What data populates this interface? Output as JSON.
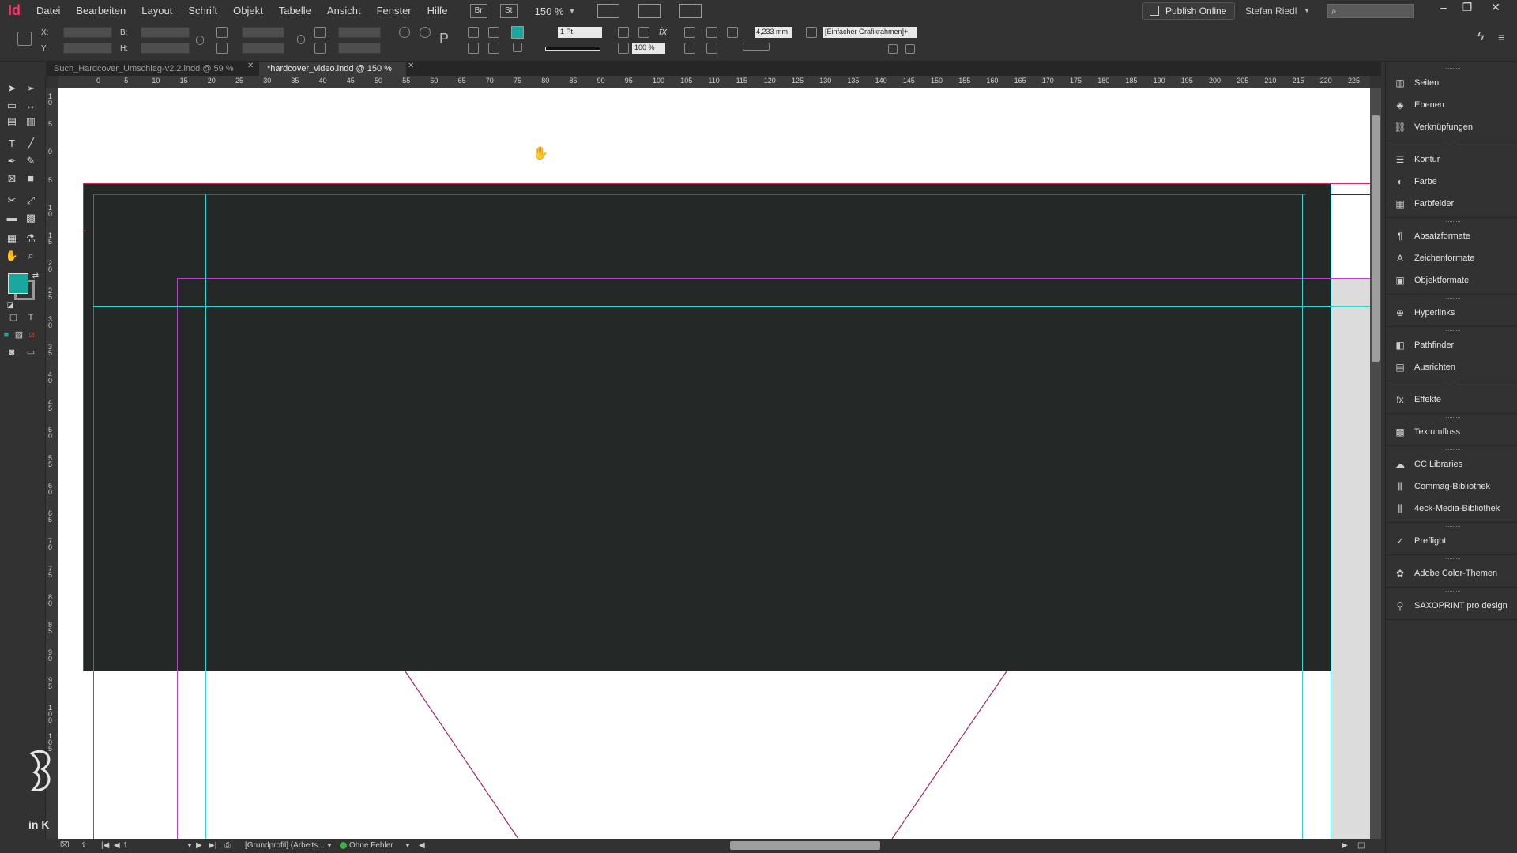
{
  "app": {
    "logo": "Id",
    "menu": [
      "Datei",
      "Bearbeiten",
      "Layout",
      "Schrift",
      "Objekt",
      "Tabelle",
      "Ansicht",
      "Fenster",
      "Hilfe"
    ],
    "bridge_label": "Br",
    "stock_label": "St",
    "zoom": "150 %",
    "publish_online": "Publish Online",
    "user": "Stefan Riedl",
    "accent_color": "#1aa89e",
    "brand_color": "#ff3366"
  },
  "control_panel": {
    "x_label": "X:",
    "y_label": "Y:",
    "w_label": "B:",
    "h_label": "H:",
    "stroke_weight": "1 Pt",
    "opacity": "100 %",
    "dimension": "4,233 mm",
    "object_style": "[Einfacher Grafikrahmen]+"
  },
  "tabs": [
    {
      "label": "Buch_Hardcover_Umschlag-v2.2.indd @ 59 %",
      "active": false
    },
    {
      "label": "*hardcover_video.indd @ 150 %",
      "active": true
    }
  ],
  "ruler_h": [
    "0",
    "5",
    "10",
    "15",
    "20",
    "25",
    "30",
    "35",
    "40",
    "45",
    "50",
    "55",
    "60",
    "65",
    "70",
    "75",
    "80",
    "85",
    "90",
    "95",
    "100",
    "105",
    "110",
    "115",
    "120",
    "125",
    "130",
    "135",
    "140",
    "145",
    "150",
    "155",
    "160",
    "165",
    "170",
    "175",
    "180",
    "185",
    "190",
    "195",
    "200",
    "205",
    "210",
    "215",
    "220",
    "225"
  ],
  "ruler_v": [
    "1\n0",
    "5",
    "0",
    "5",
    "1\n0",
    "1\n5",
    "2\n0",
    "2\n5",
    "3\n0",
    "3\n5",
    "4\n0",
    "4\n5",
    "5\n0",
    "5\n5",
    "6\n0",
    "6\n5",
    "7\n0",
    "7\n5",
    "8\n0",
    "8\n5",
    "9\n0",
    "9\n5",
    "1\n0\n0",
    "1\n0\n5"
  ],
  "panels": [
    {
      "label": "Seiten",
      "icon": "pages-icon",
      "glyph": "▥"
    },
    {
      "label": "Ebenen",
      "icon": "layers-icon",
      "glyph": "◈"
    },
    {
      "label": "Verknüpfungen",
      "icon": "links-icon",
      "glyph": "⛓"
    },
    {
      "label": "Kontur",
      "icon": "stroke-icon",
      "glyph": "☰"
    },
    {
      "label": "Farbe",
      "icon": "color-icon",
      "glyph": "◐"
    },
    {
      "label": "Farbfelder",
      "icon": "swatches-icon",
      "glyph": "▦"
    },
    {
      "label": "Absatzformate",
      "icon": "paragraph-styles-icon",
      "glyph": "¶"
    },
    {
      "label": "Zeichenformate",
      "icon": "character-styles-icon",
      "glyph": "A"
    },
    {
      "label": "Objektformate",
      "icon": "object-styles-icon",
      "glyph": "▣"
    },
    {
      "label": "Hyperlinks",
      "icon": "hyperlinks-icon",
      "glyph": "⊕"
    },
    {
      "label": "Pathfinder",
      "icon": "pathfinder-icon",
      "glyph": "◧"
    },
    {
      "label": "Ausrichten",
      "icon": "align-icon",
      "glyph": "▤"
    },
    {
      "label": "Effekte",
      "icon": "effects-icon",
      "glyph": "fx"
    },
    {
      "label": "Textumfluss",
      "icon": "text-wrap-icon",
      "glyph": "▩"
    },
    {
      "label": "CC Libraries",
      "icon": "cc-libraries-icon",
      "glyph": "☁"
    },
    {
      "label": "Commag-Bibliothek",
      "icon": "library-icon",
      "glyph": "⫼"
    },
    {
      "label": "4eck-Media-Bibliothek",
      "icon": "library-icon",
      "glyph": "⫼"
    },
    {
      "label": "Preflight",
      "icon": "preflight-icon",
      "glyph": "✓"
    },
    {
      "label": "Adobe Color-Themen",
      "icon": "color-themes-icon",
      "glyph": "✿"
    },
    {
      "label": "SAXOPRINT pro design",
      "icon": "saxoprint-icon",
      "glyph": "⚲"
    }
  ],
  "status": {
    "page": "1",
    "profile": "[Grundprofil] (Arbeits...",
    "preflight": "Ohne Fehler",
    "preflight_color": "#3cb043"
  },
  "watermark": "in K"
}
